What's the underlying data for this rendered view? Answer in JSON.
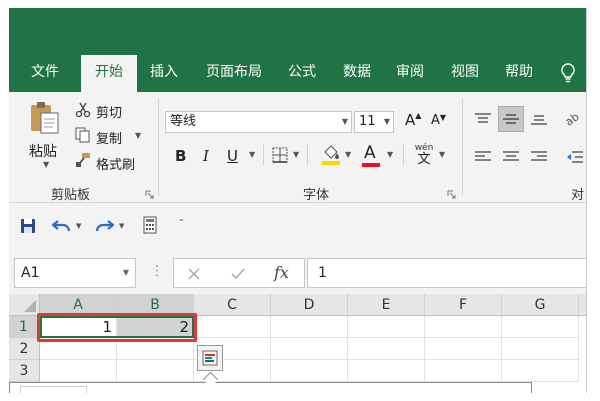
{
  "tabs": [
    {
      "label": "文件",
      "active": false
    },
    {
      "label": "开始",
      "active": true
    },
    {
      "label": "插入",
      "active": false
    },
    {
      "label": "页面布局",
      "active": false
    },
    {
      "label": "公式",
      "active": false
    },
    {
      "label": "数据",
      "active": false
    },
    {
      "label": "审阅",
      "active": false
    },
    {
      "label": "视图",
      "active": false
    },
    {
      "label": "帮助",
      "active": false
    }
  ],
  "clipboard": {
    "paste_label": "粘贴",
    "cut_label": "剪切",
    "copy_label": "复制",
    "format_painter_label": "格式刷",
    "group_label": "剪贴板"
  },
  "font": {
    "font_name": "等线",
    "font_size": "11",
    "group_label": "字体",
    "bold": "B",
    "italic": "I",
    "underline": "U",
    "increase_glyph": "A",
    "decrease_glyph": "A",
    "font_color_glyph": "A",
    "phonetic_top": "wén",
    "phonetic_bottom": "文",
    "font_color": "#e81123",
    "fill_color": "#ffd400"
  },
  "alignment": {
    "group_label_partial": "对齐"
  },
  "formula_bar": {
    "name_box": "A1",
    "fx": "fx",
    "value": "1"
  },
  "grid": {
    "columns": [
      "A",
      "B",
      "C",
      "D",
      "E",
      "F",
      "G"
    ],
    "rows": [
      "1",
      "2",
      "3"
    ],
    "cells": {
      "A1": "1",
      "B1": "2"
    },
    "highlight_color": "#e53935",
    "accent": "#217346"
  }
}
